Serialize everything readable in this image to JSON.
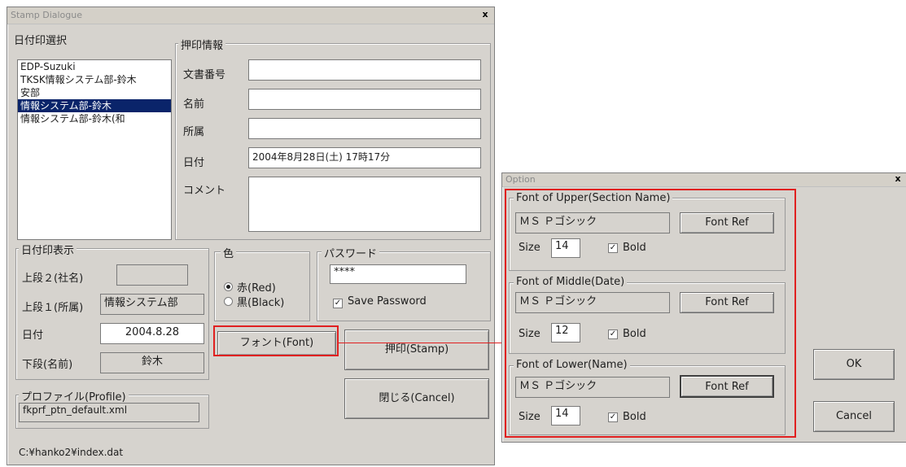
{
  "stamp_dialog": {
    "title": "Stamp Dialogue",
    "close_glyph": "x",
    "date_stamp_select": {
      "label": "日付印選択",
      "items": [
        "EDP-Suzuki",
        "TKSK情報システム部-鈴木",
        "安部",
        "情報システム部-鈴木",
        "情報システム部-鈴木(和"
      ],
      "selected_index": 3
    },
    "stamp_info": {
      "label": "押印情報",
      "doc_number_label": "文書番号",
      "doc_number_value": "",
      "name_label": "名前",
      "name_value": "",
      "affiliation_label": "所属",
      "affiliation_value": "",
      "date_label": "日付",
      "date_value": "2004年8月28日(土) 17時17分",
      "comment_label": "コメント",
      "comment_value": ""
    },
    "date_display": {
      "label": "日付印表示",
      "upper2_label": "上段２(社名)",
      "upper2_value": "",
      "upper1_label": "上段１(所属)",
      "upper1_value": "情報システム部",
      "date_label": "日付",
      "date_value": "2004.8.28",
      "lower_label": "下段(名前)",
      "lower_value": "鈴木"
    },
    "color": {
      "label": "色",
      "red_label": "赤(Red)",
      "black_label": "黒(Black)",
      "selected": "red"
    },
    "password": {
      "label": "パスワード",
      "value": "****",
      "save_label": "Save Password",
      "save_checked": true
    },
    "font_button": "フォント(Font)",
    "stamp_button": "押印(Stamp)",
    "cancel_button": "閉じる(Cancel)",
    "profile": {
      "label": "プロファイル(Profile)",
      "value": "fkprf_ptn_default.xml"
    },
    "status_path": "C:¥hanko2¥index.dat"
  },
  "option_dialog": {
    "title": "Option",
    "close_glyph": "x",
    "upper": {
      "label": "Font of Upper(Section Name)",
      "font": "ＭＳ Ｐゴシック",
      "font_ref": "Font Ref",
      "size_label": "Size",
      "size": "14",
      "bold_label": "Bold",
      "bold": true
    },
    "middle": {
      "label": "Font of Middle(Date)",
      "font": "ＭＳ Ｐゴシック",
      "font_ref": "Font Ref",
      "size_label": "Size",
      "size": "12",
      "bold_label": "Bold",
      "bold": true
    },
    "lower": {
      "label": "Font of Lower(Name)",
      "font": "ＭＳ Ｐゴシック",
      "font_ref": "Font Ref",
      "size_label": "Size",
      "size": "14",
      "bold_label": "Bold",
      "bold": true
    },
    "ok_button": "OK",
    "cancel_button": "Cancel"
  },
  "colors": {
    "dialog_bg": "#d6d3ce",
    "selection": "#0a246a",
    "highlight": "#e02020"
  }
}
